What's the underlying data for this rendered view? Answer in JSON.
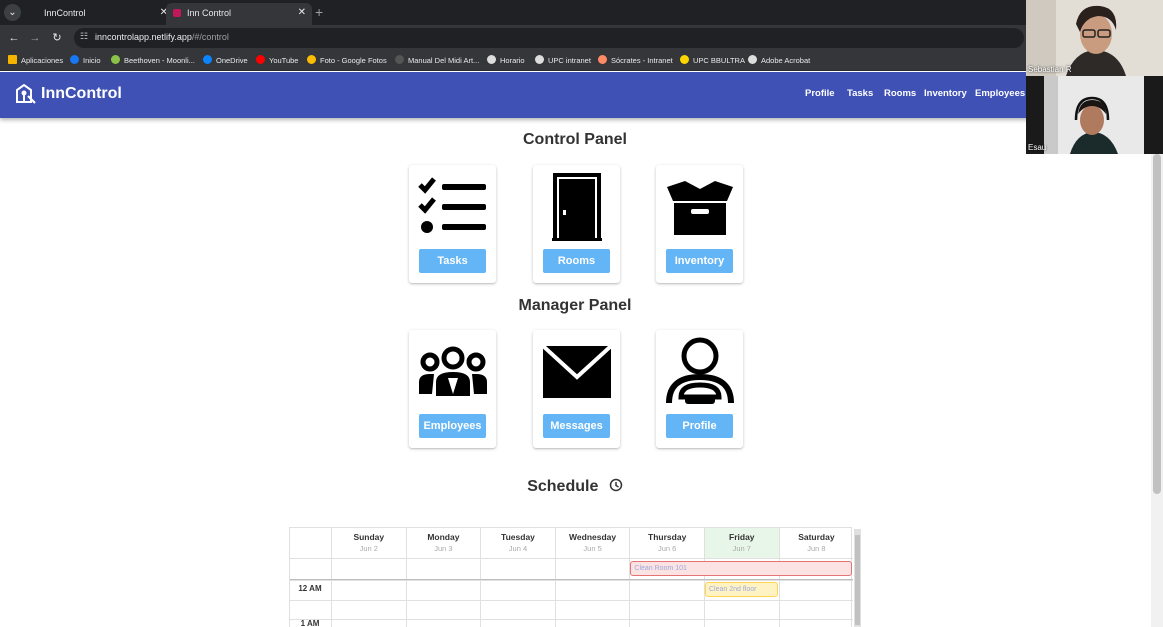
{
  "browser": {
    "tabs": [
      {
        "title": "InnControl",
        "active": false
      },
      {
        "title": "Inn Control",
        "active": true
      }
    ],
    "url_host": "inncontrolapp.netlify.app",
    "url_path": "/#/control",
    "bookmarks": [
      {
        "label": "Aplicaciones",
        "icon": "apps-grid-icon",
        "color": "#f4b400"
      },
      {
        "label": "Inicio",
        "icon": "facebook-icon",
        "color": "#1877f2"
      },
      {
        "label": "Beethoven - Moonli...",
        "icon": "music-icon",
        "color": "#8bc34a"
      },
      {
        "label": "OneDrive",
        "icon": "cloud-icon",
        "color": "#0a84ff"
      },
      {
        "label": "YouTube",
        "icon": "youtube-icon",
        "color": "#ff0000"
      },
      {
        "label": "Foto - Google Fotos",
        "icon": "pinwheel-icon",
        "color": "#fbbc04"
      },
      {
        "label": "Manual Del Midi Art...",
        "icon": "doc-icon",
        "color": "#555555"
      },
      {
        "label": "Horario",
        "icon": "globe-icon",
        "color": "#dddddd"
      },
      {
        "label": "UPC intranet",
        "icon": "globe-icon",
        "color": "#dddddd"
      },
      {
        "label": "Sócrates - Intranet",
        "icon": "person-icon",
        "color": "#ff8a65"
      },
      {
        "label": "UPC BBULTRA",
        "icon": "upc-icon",
        "color": "#ffd600"
      },
      {
        "label": "Adobe Acrobat",
        "icon": "globe-icon",
        "color": "#dddddd"
      }
    ]
  },
  "app": {
    "brand": "InnControl",
    "nav": [
      "Profile",
      "Tasks",
      "Rooms",
      "Inventory",
      "Employees"
    ],
    "control_panel": {
      "title": "Control Panel",
      "cards": [
        {
          "label": "Tasks",
          "icon": "checklist-icon"
        },
        {
          "label": "Rooms",
          "icon": "door-icon"
        },
        {
          "label": "Inventory",
          "icon": "box-icon"
        }
      ]
    },
    "manager_panel": {
      "title": "Manager Panel",
      "cards": [
        {
          "label": "Employees",
          "icon": "group-icon"
        },
        {
          "label": "Messages",
          "icon": "envelope-icon"
        },
        {
          "label": "Profile",
          "icon": "user-icon"
        }
      ]
    },
    "schedule": {
      "title": "Schedule",
      "days": [
        {
          "name": "Sunday",
          "date": "Jun 2"
        },
        {
          "name": "Monday",
          "date": "Jun 3"
        },
        {
          "name": "Tuesday",
          "date": "Jun 4"
        },
        {
          "name": "Wednesday",
          "date": "Jun 5"
        },
        {
          "name": "Thursday",
          "date": "Jun 6"
        },
        {
          "name": "Friday",
          "date": "Jun 7",
          "today": true
        },
        {
          "name": "Saturday",
          "date": "Jun 8"
        }
      ],
      "time_labels": [
        "12 AM",
        "1 AM"
      ],
      "events": [
        {
          "title": "Clean Room 101",
          "start_day": "Thursday",
          "end_day": "Saturday",
          "all_day": true
        },
        {
          "title": "Clean 2nd floor",
          "day": "Friday",
          "time": "12 AM"
        }
      ],
      "today_color": "#e8f5e9"
    }
  },
  "call": {
    "participants": [
      "Sebastian R",
      "Esau"
    ]
  },
  "colors": {
    "appbar": "#3f51b5",
    "button": "#64b5f6"
  }
}
